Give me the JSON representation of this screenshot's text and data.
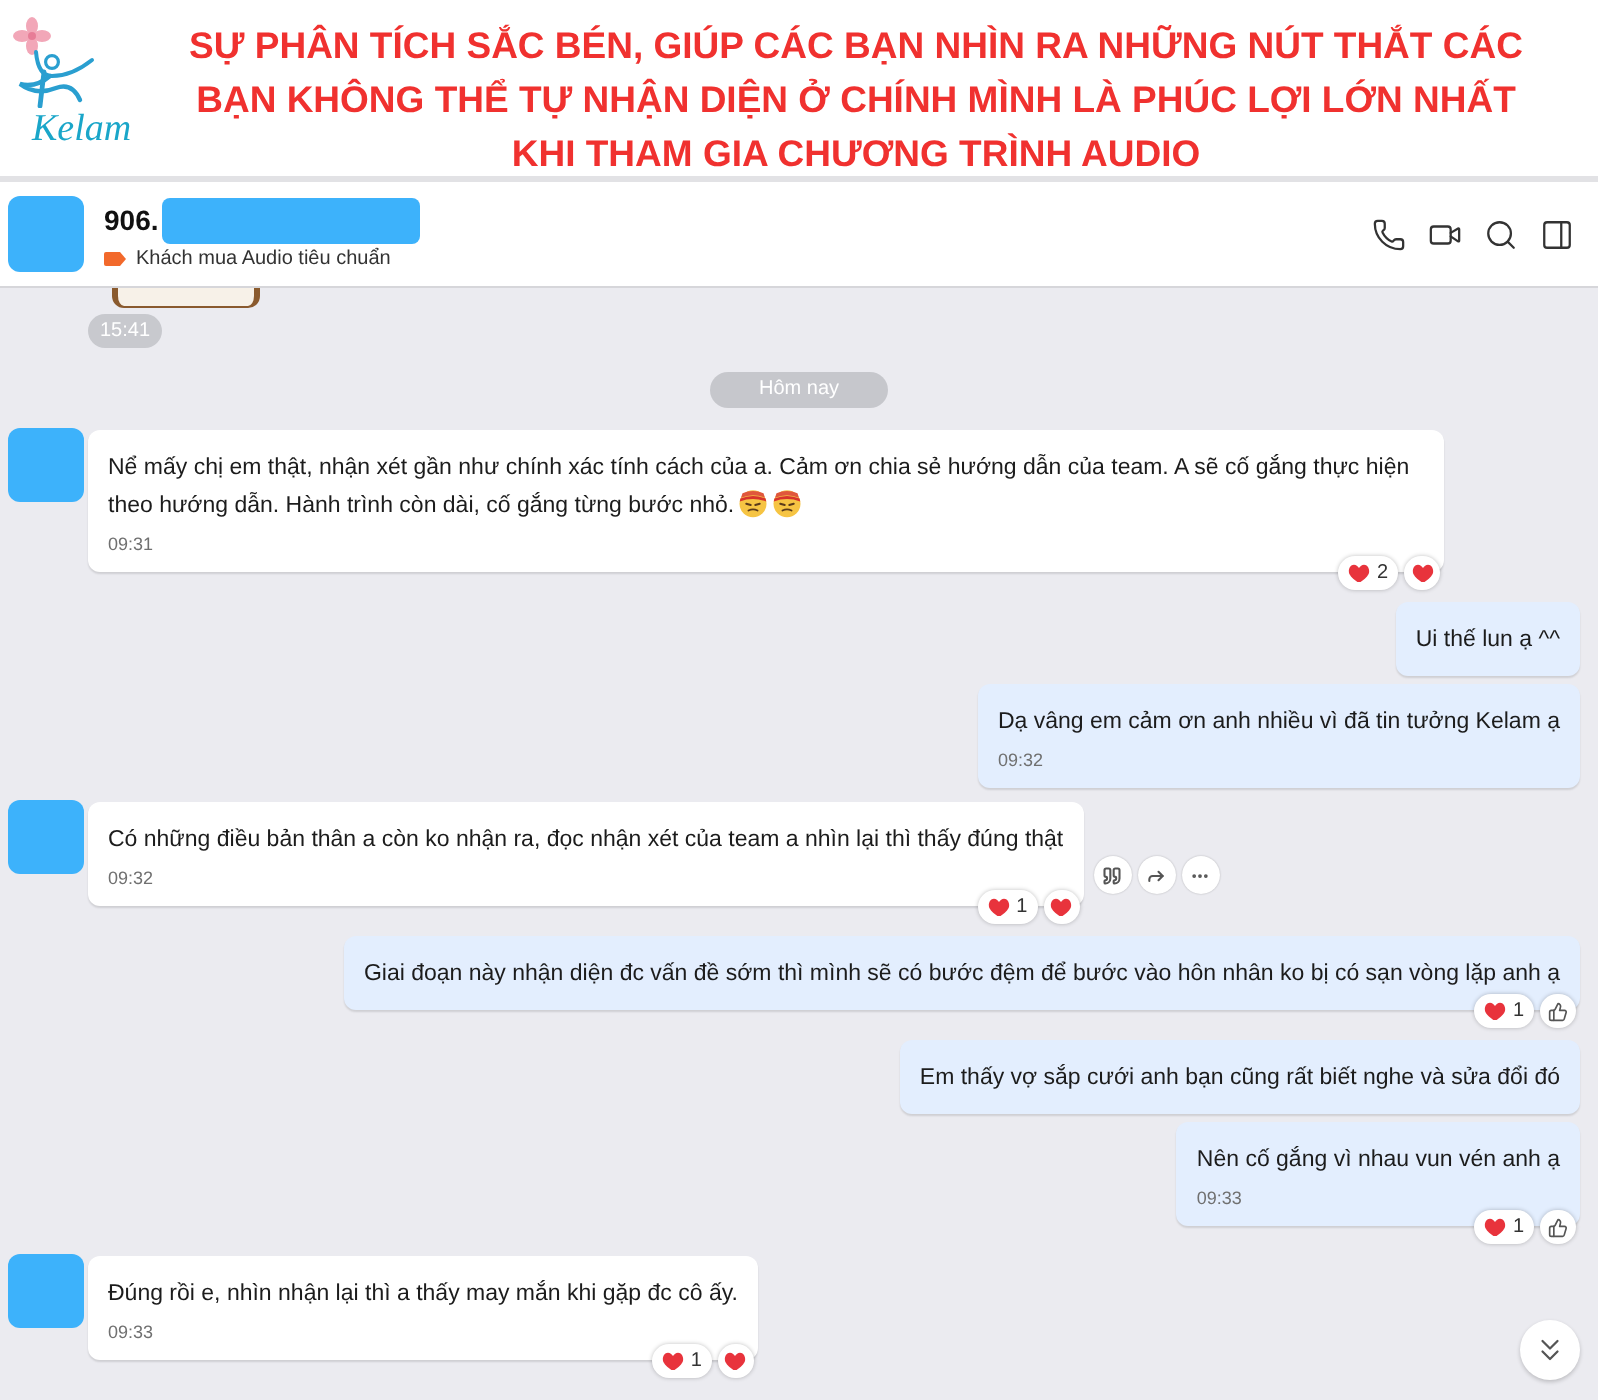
{
  "banner": {
    "logo_text": "Kelam",
    "title_lines": [
      "SỰ PHÂN TÍCH SẮC BÉN, GIÚP CÁC BẠN NHÌN RA NHỮNG NÚT THẮT CÁC",
      "BẠN KHÔNG THỂ TỰ NHẬN DIỆN Ở CHÍNH MÌNH LÀ PHÚC LỢI LỚN NHẤT",
      "KHI THAM GIA CHƯƠNG TRÌNH AUDIO"
    ]
  },
  "chat_header": {
    "name": "906.",
    "name_redacted": true,
    "tag": "Khách mua Audio tiêu chuẩn",
    "actions": [
      {
        "kind": "phone"
      },
      {
        "kind": "video"
      },
      {
        "kind": "search"
      },
      {
        "kind": "panel"
      }
    ]
  },
  "chat": {
    "earlier_photo": true,
    "earlier_time": "15:41",
    "date_divider": "Hôm nay",
    "scroll_down_button": true,
    "messages": [
      {
        "kind": "received",
        "text": "Nể mấy chị em thật, nhận xét gần như chính xác tính cách của a. Cảm ơn chia sẻ hướng dẫn của team. A sẽ cố gắng thực hiện theo hướng dẫn. Hành trình còn dài, cố gắng từng bước nhỏ.",
        "emojis": [
          {
            "kind": "headband-face"
          },
          {
            "kind": "headband-face"
          }
        ],
        "time": "09:31",
        "reactions": [
          {
            "kind": "heart",
            "count": "2"
          },
          {
            "kind": "heart"
          }
        ]
      },
      {
        "kind": "sent",
        "text": "Ui thế lun ạ ^^"
      },
      {
        "kind": "sent",
        "text": "Dạ vâng em cảm ơn anh nhiều vì đã tin tưởng Kelam ạ",
        "time": "09:32"
      },
      {
        "kind": "received",
        "text": "Có những điều bản thân a còn ko nhận ra, đọc nhận xét của team a nhìn lại thì thấy đúng thật",
        "time": "09:32",
        "reactions": [
          {
            "kind": "heart",
            "count": "1"
          },
          {
            "kind": "heart"
          }
        ],
        "actions": [
          {
            "kind": "quote"
          },
          {
            "kind": "forward"
          },
          {
            "kind": "more"
          }
        ]
      },
      {
        "kind": "sent",
        "text": "Giai đoạn này nhận diện đc vấn đề sớm thì mình sẽ có bước đệm để bước vào hôn nhân ko bị có sạn vòng lặp anh ạ",
        "reactions": [
          {
            "kind": "heart",
            "count": "1"
          },
          {
            "kind": "like"
          }
        ]
      },
      {
        "kind": "sent",
        "text": "Em thấy vợ sắp cưới anh bạn cũng rất biết nghe và sửa đổi đó"
      },
      {
        "kind": "sent",
        "text": "Nên cố gắng vì nhau vun vén anh ạ",
        "time": "09:33",
        "reactions": [
          {
            "kind": "heart",
            "count": "1"
          },
          {
            "kind": "like"
          }
        ]
      },
      {
        "kind": "received",
        "text": "Đúng rồi e, nhìn nhận lại thì a thấy may mắn khi gặp đc cô ấy.",
        "time": "09:33",
        "reactions": [
          {
            "kind": "heart",
            "count": "1"
          },
          {
            "kind": "heart"
          }
        ]
      }
    ]
  }
}
